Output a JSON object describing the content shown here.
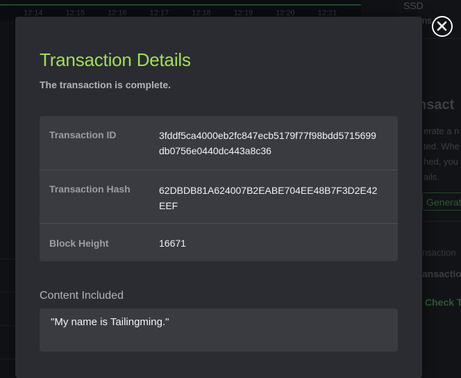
{
  "background": {
    "chart_times": [
      "12:14",
      "12:15",
      "12:16",
      "12:17",
      "12:18",
      "12:19",
      "12:20",
      "12:21"
    ],
    "right_panel": {
      "label": "SSD",
      "row_fragment": "ns 96",
      "heading_fragment": "nsact",
      "description_fragment": "erate a n\nted. Whe\nhed, you\nails.",
      "button_fragment": "Generat",
      "sub_fragment": "nsaction",
      "sub_fragment_bold": "ansaction",
      "link_fragment": "Check T"
    }
  },
  "modal": {
    "title": "Transaction Details",
    "subtitle": "The transaction is complete.",
    "details": [
      {
        "label": "Transaction ID",
        "value": "3fddf5ca4000eb2fc847ecb5179f77f98bdd5715699db0756e0440dc443a8c36"
      },
      {
        "label": "Transaction Hash",
        "value": "62DBDB81A624007B2EABE704EE48B7F3D2E42EEF"
      },
      {
        "label": "Block Height",
        "value": "16671"
      }
    ],
    "content_label": "Content Included",
    "content_value": "\"My name is Tailingming.\""
  },
  "close_button": {
    "icon": "close-icon"
  },
  "colors": {
    "accent": "#9fe05a",
    "modal_bg": "#2b2c31",
    "panel_bg": "#3a3b41"
  }
}
